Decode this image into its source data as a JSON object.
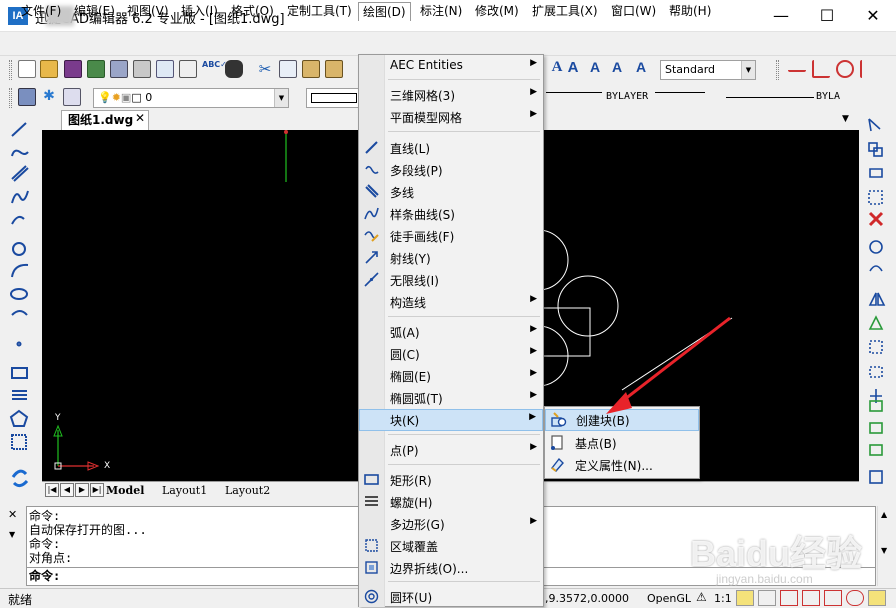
{
  "title": "迅捷CAD编辑器 6.2 专业版 - [图纸1.dwg]",
  "app_logo": "IA",
  "menubar": [
    "文件(F)",
    "编辑(E)",
    "视图(V)",
    "插入(I)",
    "格式(O)",
    "定制工具(T)",
    "绘图(D)",
    "标注(N)",
    "修改(M)",
    "扩展工具(X)",
    "窗口(W)",
    "帮助(H)"
  ],
  "toolbar": {
    "text_style": "Standard",
    "layer": "0",
    "linetype": "BYLAYER",
    "lineweight": "BYLA"
  },
  "doc_tab": {
    "label": "图纸1.dwg",
    "close": "✕"
  },
  "canvas": {
    "ucs_x": "X",
    "ucs_y": "Y"
  },
  "layout_tabs": [
    "Model",
    "Layout1",
    "Layout2"
  ],
  "command_lines": [
    "命令:",
    "自动保存打开的图...",
    "命令:",
    "对角点:",
    "命令:"
  ],
  "status": {
    "text": "就绪",
    "coords": ",9.3572,0.0000",
    "render": "OpenGL",
    "scale": "1:1"
  },
  "draw_menu": {
    "items": [
      {
        "label": "AEC Entities",
        "sub": true,
        "icon": ""
      },
      {
        "label": "三维网格(3)",
        "sub": true,
        "icon": ""
      },
      {
        "label": "平面模型网格",
        "sub": true,
        "icon": ""
      },
      {
        "label": "直线(L)",
        "sub": false,
        "icon": "line-icon"
      },
      {
        "label": "多段线(P)",
        "sub": false,
        "icon": "polyline-icon"
      },
      {
        "label": "多线",
        "sub": false,
        "icon": "multiline-icon"
      },
      {
        "label": "样条曲线(S)",
        "sub": false,
        "icon": "spline-icon"
      },
      {
        "label": "徒手画线(F)",
        "sub": false,
        "icon": "freehand-icon"
      },
      {
        "label": "射线(Y)",
        "sub": false,
        "icon": "ray-icon"
      },
      {
        "label": "无限线(I)",
        "sub": false,
        "icon": "xline-icon"
      },
      {
        "label": "构造线",
        "sub": true,
        "icon": ""
      },
      {
        "label": "弧(A)",
        "sub": true,
        "icon": ""
      },
      {
        "label": "圆(C)",
        "sub": true,
        "icon": ""
      },
      {
        "label": "椭圆(E)",
        "sub": true,
        "icon": ""
      },
      {
        "label": "椭圆弧(T)",
        "sub": true,
        "icon": ""
      },
      {
        "label": "块(K)",
        "sub": true,
        "icon": ""
      },
      {
        "label": "点(P)",
        "sub": true,
        "icon": ""
      },
      {
        "label": "矩形(R)",
        "sub": false,
        "icon": "rectangle-icon"
      },
      {
        "label": "螺旋(H)",
        "sub": false,
        "icon": "helix-icon"
      },
      {
        "label": "多边形(G)",
        "sub": true,
        "icon": ""
      },
      {
        "label": "区域覆盖",
        "sub": false,
        "icon": "wipeout-icon"
      },
      {
        "label": "边界折线(O)...",
        "sub": false,
        "icon": "boundary-icon"
      },
      {
        "label": "圆环(U)",
        "sub": false,
        "icon": "donut-icon"
      }
    ]
  },
  "block_submenu": {
    "items": [
      "创建块(B)",
      "基点(B)",
      "定义属性(N)..."
    ]
  },
  "watermark": {
    "main": "Baidu经验",
    "sub": "jingyan.baidu.com"
  },
  "colors": {
    "menu_highlight": "#cde3f7",
    "canvas": "#000000",
    "arrow": "#e8232a"
  }
}
